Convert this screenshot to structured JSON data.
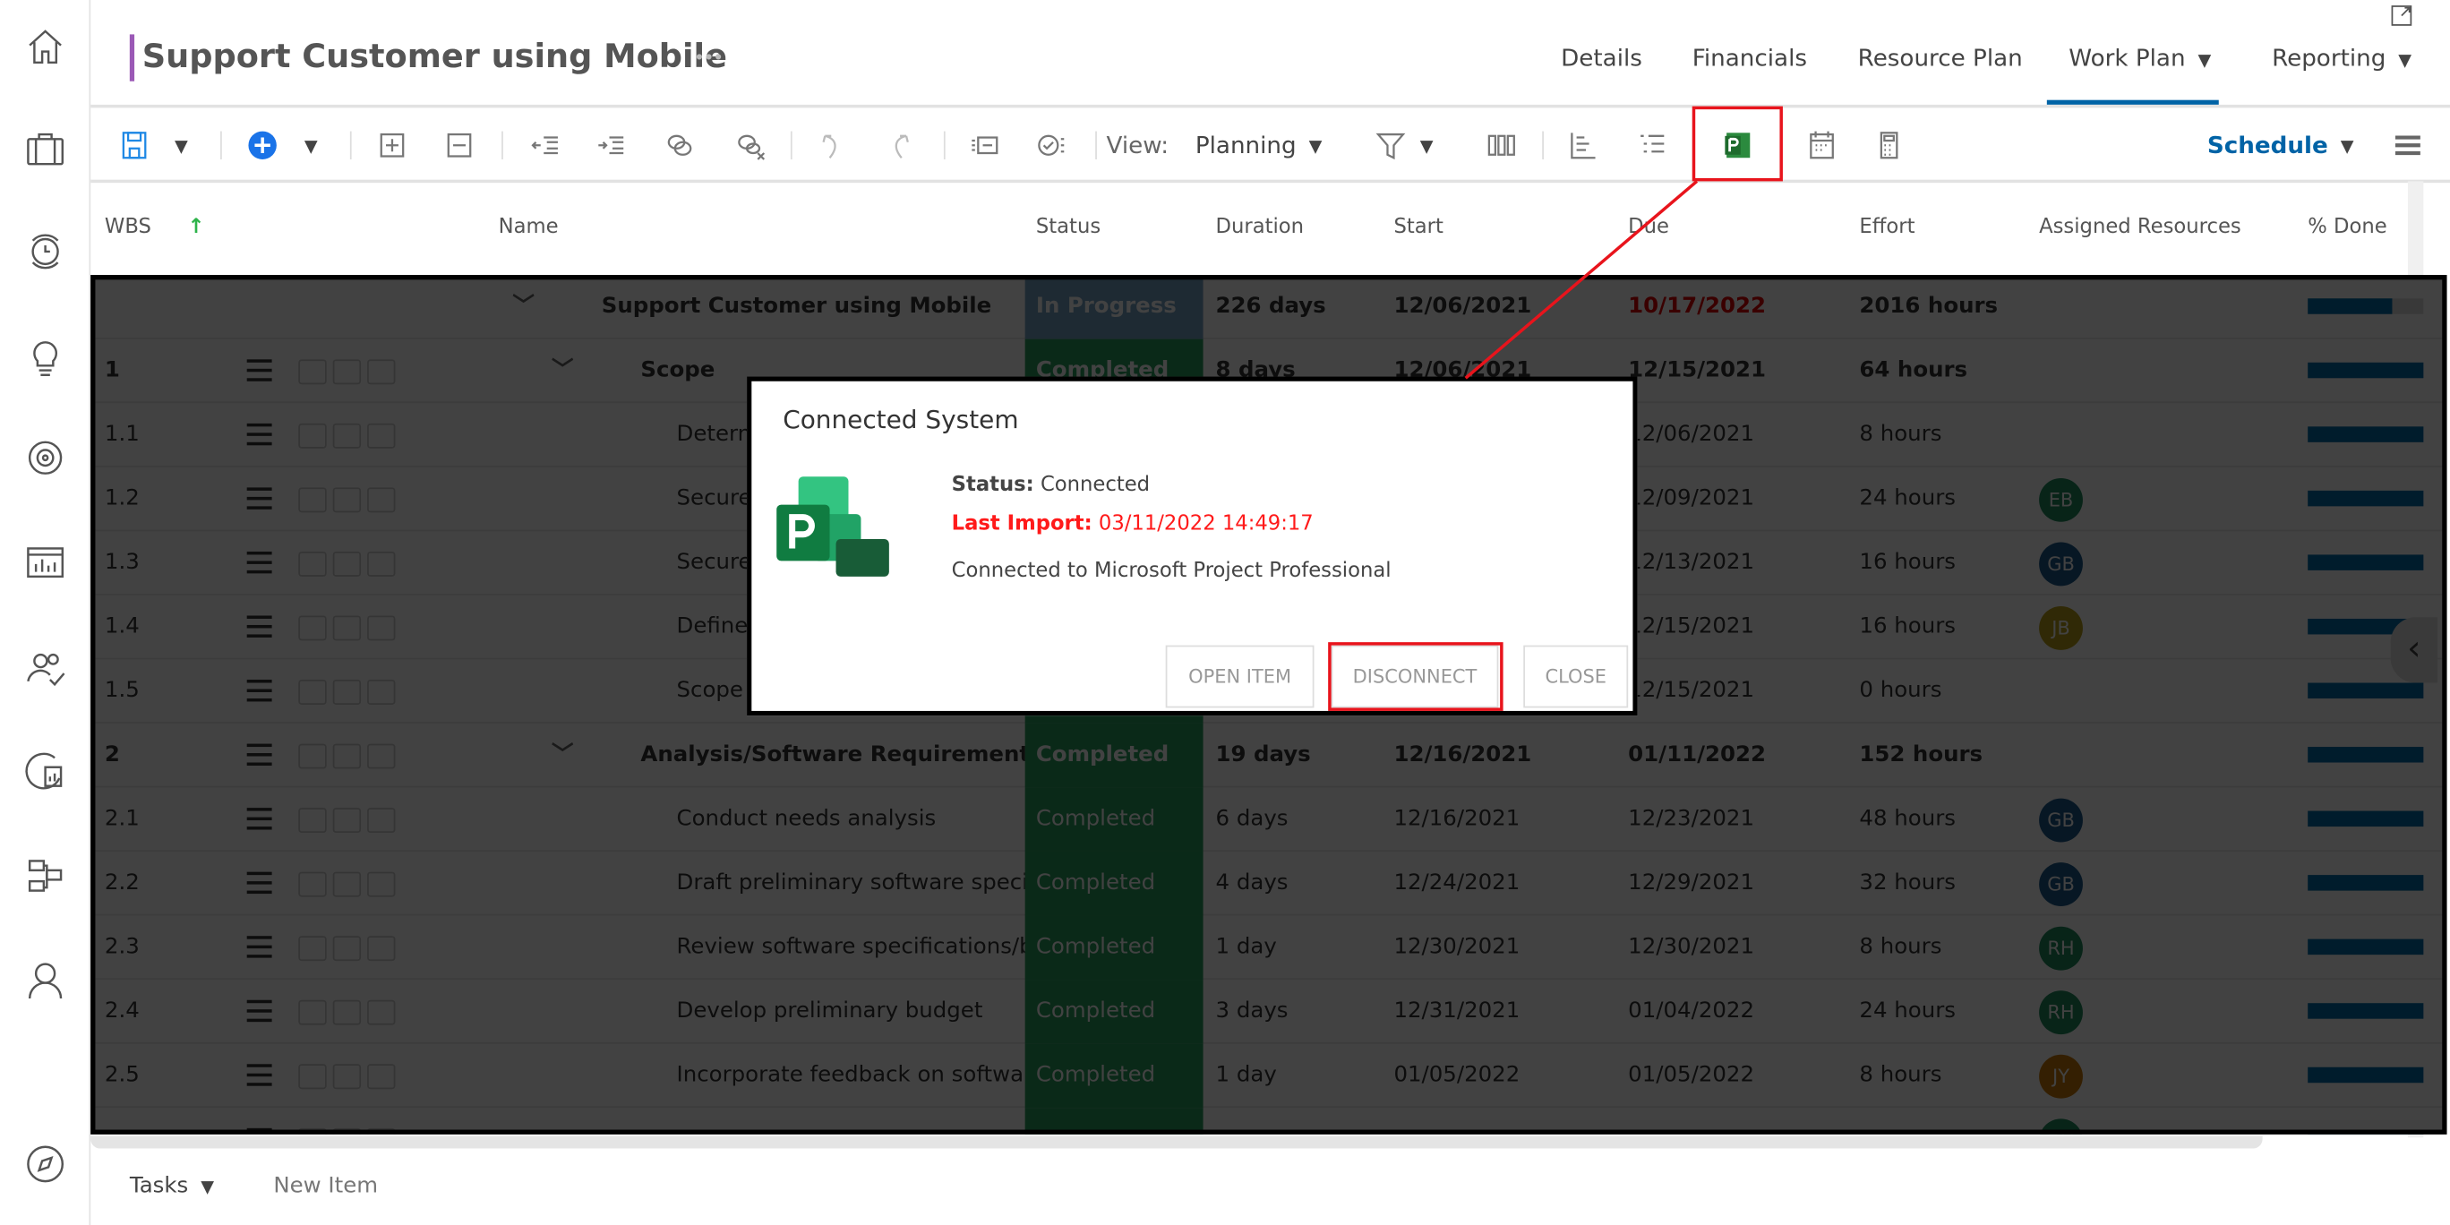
{
  "header": {
    "title": "Support Customer using Mobile",
    "more": "•••",
    "nav": [
      {
        "label": "Details",
        "dropdown": false
      },
      {
        "label": "Financials",
        "dropdown": false
      },
      {
        "label": "Resource Plan",
        "dropdown": false
      },
      {
        "label": "Work Plan",
        "dropdown": true,
        "active": true
      },
      {
        "label": "Reporting",
        "dropdown": true
      }
    ]
  },
  "sidebar": {
    "icons": [
      "home-icon",
      "briefcase-icon",
      "timesheet-clock-icon",
      "idea-lightbulb-icon",
      "target-icon",
      "dashboard-chart-icon",
      "people-check-icon",
      "report-icon",
      "org-chart-icon",
      "user-icon",
      "compass-icon"
    ]
  },
  "toolbar": {
    "view_label": "View:",
    "view_value": "Planning",
    "schedule_label": "Schedule"
  },
  "columns": [
    "WBS",
    "Name",
    "Status",
    "Duration",
    "Start",
    "Due",
    "Effort",
    "Assigned Resources",
    "% Done"
  ],
  "rows": [
    {
      "wbs": "",
      "name": "Support Customer using Mobile",
      "level": 0,
      "status": "In Progress",
      "duration": "226 days",
      "start": "12/06/2021",
      "due": "10/17/2022",
      "due_overdue": true,
      "effort": "2016 hours",
      "resource": "",
      "done": 0.73,
      "bold": true,
      "expandable": true
    },
    {
      "wbs": "1",
      "name": "Scope",
      "level": 1,
      "status": "Completed",
      "duration": "8 days",
      "start": "12/06/2021",
      "due": "12/15/2021",
      "effort": "64 hours",
      "resource": "",
      "done": 1,
      "bold": true,
      "expandable": true
    },
    {
      "wbs": "1.1",
      "name": "Determ",
      "level": 2,
      "status": "Completed",
      "duration": "",
      "start": "",
      "due": "12/06/2021",
      "effort": "8 hours",
      "resource": "",
      "done": 1
    },
    {
      "wbs": "1.2",
      "name": "Secure",
      "level": 2,
      "status": "Completed",
      "duration": "",
      "start": "",
      "due": "12/09/2021",
      "effort": "24 hours",
      "resource": "EB",
      "done": 1
    },
    {
      "wbs": "1.3",
      "name": "Secure",
      "level": 2,
      "status": "Completed",
      "duration": "",
      "start": "",
      "due": "12/13/2021",
      "effort": "16 hours",
      "resource": "GB",
      "done": 1
    },
    {
      "wbs": "1.4",
      "name": "Define",
      "level": 2,
      "status": "Completed",
      "duration": "",
      "start": "",
      "due": "12/15/2021",
      "effort": "16 hours",
      "resource": "JB",
      "done": 1
    },
    {
      "wbs": "1.5",
      "name": "Scope",
      "level": 2,
      "status": "Completed",
      "duration": "",
      "start": "",
      "due": "12/15/2021",
      "effort": "0 hours",
      "resource": "",
      "done": 1
    },
    {
      "wbs": "2",
      "name": "Analysis/Software Requirements",
      "level": 1,
      "status": "Completed",
      "duration": "19 days",
      "start": "12/16/2021",
      "due": "01/11/2022",
      "effort": "152 hours",
      "resource": "",
      "done": 1,
      "bold": true,
      "expandable": true
    },
    {
      "wbs": "2.1",
      "name": "Conduct needs analysis",
      "level": 2,
      "status": "Completed",
      "duration": "6 days",
      "start": "12/16/2021",
      "due": "12/23/2021",
      "effort": "48 hours",
      "resource": "GB",
      "done": 1
    },
    {
      "wbs": "2.2",
      "name": "Draft preliminary software specific",
      "level": 2,
      "status": "Completed",
      "duration": "4 days",
      "start": "12/24/2021",
      "due": "12/29/2021",
      "effort": "32 hours",
      "resource": "GB",
      "done": 1
    },
    {
      "wbs": "2.3",
      "name": "Review software specifications/bu",
      "level": 2,
      "status": "Completed",
      "duration": "1 day",
      "start": "12/30/2021",
      "due": "12/30/2021",
      "effort": "8 hours",
      "resource": "RH",
      "done": 1
    },
    {
      "wbs": "2.4",
      "name": "Develop preliminary budget",
      "level": 2,
      "status": "Completed",
      "duration": "3 days",
      "start": "12/31/2021",
      "due": "01/04/2022",
      "effort": "24 hours",
      "resource": "RH",
      "done": 1
    },
    {
      "wbs": "2.5",
      "name": "Incorporate feedback on software",
      "level": 2,
      "status": "Completed",
      "duration": "1 day",
      "start": "01/05/2022",
      "due": "01/05/2022",
      "effort": "8 hours",
      "resource": "JY",
      "done": 1
    },
    {
      "wbs": "",
      "name": "",
      "level": 2,
      "status": "",
      "duration": "",
      "start": "",
      "due": "",
      "effort": "",
      "resource": "RH",
      "done": 1
    }
  ],
  "avatar_colors": {
    "EB": "#1f8a5e",
    "GB": "#1e5a8c",
    "JB": "#b8a01a",
    "RH": "#1f8a5e",
    "JY": "#c77a0a"
  },
  "colors": {
    "completed": "#2a9d5c",
    "in_progress": "#73a2c4",
    "progress": "#006caa",
    "overdue": "#e00000",
    "accent": "#0063a6",
    "annotation": "#e8141c"
  },
  "dialog": {
    "title": "Connected System",
    "status_label": "Status:",
    "status_value": "Connected",
    "import_label": "Last Import:",
    "import_value": "03/11/2022 14:49:17",
    "message": "Connected to Microsoft Project Professional",
    "buttons": {
      "open": "OPEN ITEM",
      "disconnect": "DISCONNECT",
      "close": "CLOSE"
    }
  },
  "footer": {
    "tasks_label": "Tasks",
    "new_item": "New Item"
  }
}
